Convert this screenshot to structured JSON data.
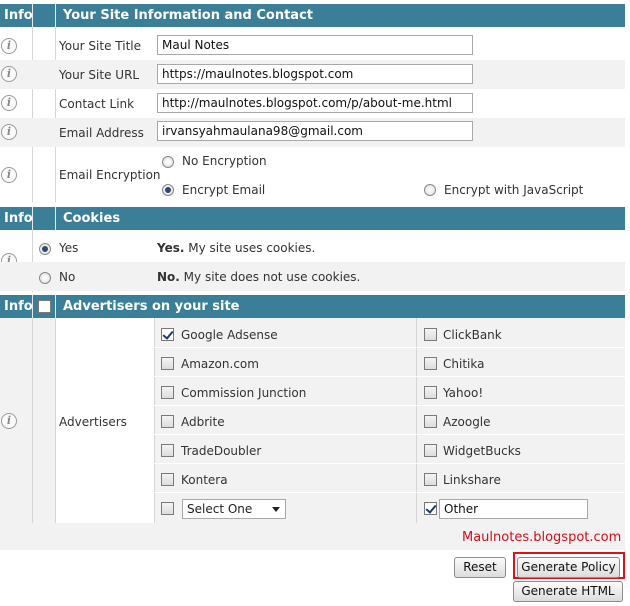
{
  "site_section": {
    "info_label": "Info",
    "title": "Your Site Information and Contact",
    "site_title_label": "Your Site Title",
    "site_title_value": "Maul Notes",
    "site_url_label": "Your Site URL",
    "site_url_value": "https://maulnotes.blogspot.com",
    "contact_link_label": "Contact Link",
    "contact_link_value": "http://maulnotes.blogspot.com/p/about-me.html",
    "email_label": "Email Address",
    "email_value": "irvansyahmaulana98@gmail.com",
    "encryption_label": "Email Encryption",
    "encryption_options": [
      "No Encryption",
      "Encrypt Email",
      "Encrypt with JavaScript"
    ],
    "encryption_selected": "Encrypt Email"
  },
  "cookies_section": {
    "info_label": "Info",
    "title": "Cookies",
    "yes_label": "Yes",
    "yes_desc_bold": "Yes.",
    "yes_desc": " My site uses cookies.",
    "no_label": "No",
    "no_desc_bold": "No.",
    "no_desc": " My site does not use cookies.",
    "selected": "Yes"
  },
  "advertisers_section": {
    "info_label": "Info",
    "title": "Advertisers on your site",
    "row_label": "Advertisers",
    "left": [
      {
        "label": "Google Adsense",
        "checked": true
      },
      {
        "label": "Amazon.com",
        "checked": false
      },
      {
        "label": "Commission Junction",
        "checked": false
      },
      {
        "label": "Adbrite",
        "checked": false
      },
      {
        "label": "TradeDoubler",
        "checked": false
      },
      {
        "label": "Kontera",
        "checked": false
      }
    ],
    "right": [
      {
        "label": "ClickBank",
        "checked": false
      },
      {
        "label": "Chitika",
        "checked": false
      },
      {
        "label": "Yahoo!",
        "checked": false
      },
      {
        "label": "Azoogle",
        "checked": false
      },
      {
        "label": "WidgetBucks",
        "checked": false
      },
      {
        "label": "Linkshare",
        "checked": false
      }
    ],
    "select_value": "Select One",
    "other_value": "Other",
    "other_checked": true
  },
  "watermark": "Maulnotes.blogspot.com",
  "buttons": {
    "reset": "Reset",
    "generate_policy": "Generate Policy",
    "generate_html": "Generate HTML"
  },
  "colors": {
    "header": "#3a7f97",
    "watermark": "#d0101a",
    "highlight": "#e0101a"
  }
}
